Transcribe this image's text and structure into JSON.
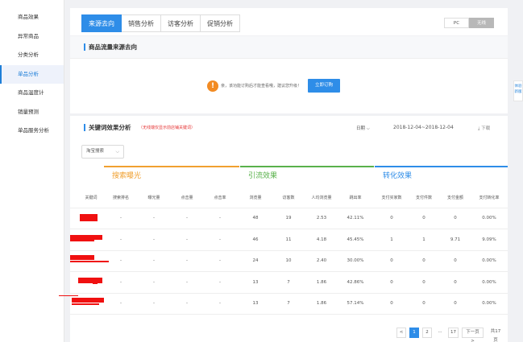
{
  "sidebar": {
    "items": [
      {
        "label": "商品效果"
      },
      {
        "label": "异常商品"
      },
      {
        "label": "分类分析"
      },
      {
        "label": "单品分析"
      },
      {
        "label": "商品温度计"
      },
      {
        "label": "销量预测"
      },
      {
        "label": "单品服务分析"
      }
    ],
    "active_index": 3
  },
  "right_hint": {
    "label": "体验新版"
  },
  "tabs": {
    "items": [
      {
        "label": "来源去向"
      },
      {
        "label": "销售分析"
      },
      {
        "label": "访客分析"
      },
      {
        "label": "促销分析"
      }
    ],
    "active_index": 0
  },
  "device_toggle": {
    "pc": "PC",
    "wireless": "无线",
    "selected": "无线"
  },
  "flow_panel": {
    "title": "商品流量来源去向",
    "notice": "亲，该功能订购后才能查看哦，建议您升级！",
    "upgrade_button": "立即订购"
  },
  "keyword_panel": {
    "title": "关键词效果分析",
    "subtitle": "（无线端仅显示前店铺关键词）",
    "date_label": "日期",
    "date_range": "2018-12-04~2018-12-04",
    "download": "下载",
    "source_select": "淘宝搜索",
    "groups": [
      {
        "label": "搜索曝光",
        "color": "#f0a030"
      },
      {
        "label": "引流效果",
        "color": "#59b14b"
      },
      {
        "label": "转化效果",
        "color": "#2e8de8"
      }
    ],
    "columns": [
      "关键词",
      "搜索排名",
      "曝光量",
      "点击量",
      "点击率",
      "浏览量",
      "访客数",
      "人均浏览量",
      "跳出率",
      "支付买家数",
      "支付件数",
      "支付金额",
      "支付转化率"
    ],
    "rows": [
      {
        "rank": "-",
        "exposure": "-",
        "clicks": "-",
        "ctr": "-",
        "pv": "48",
        "uv": "19",
        "avg_pv": "2.53",
        "bounce": "42.11%",
        "buyers": "0",
        "pieces": "0",
        "amount": "0",
        "conv": "0.00%"
      },
      {
        "rank": "-",
        "exposure": "-",
        "clicks": "-",
        "ctr": "-",
        "pv": "46",
        "uv": "11",
        "avg_pv": "4.18",
        "bounce": "45.45%",
        "buyers": "1",
        "pieces": "1",
        "amount": "9.71",
        "conv": "9.09%"
      },
      {
        "rank": "-",
        "exposure": "-",
        "clicks": "-",
        "ctr": "-",
        "pv": "24",
        "uv": "10",
        "avg_pv": "2.40",
        "bounce": "30.00%",
        "buyers": "0",
        "pieces": "0",
        "amount": "0",
        "conv": "0.00%"
      },
      {
        "rank": "-",
        "exposure": "-",
        "clicks": "-",
        "ctr": "-",
        "pv": "13",
        "uv": "7",
        "avg_pv": "1.86",
        "bounce": "42.86%",
        "buyers": "0",
        "pieces": "0",
        "amount": "0",
        "conv": "0.00%"
      },
      {
        "rank": "-",
        "exposure": "-",
        "clicks": "-",
        "ctr": "-",
        "pv": "13",
        "uv": "7",
        "avg_pv": "1.86",
        "bounce": "57.14%",
        "buyers": "0",
        "pieces": "0",
        "amount": "0",
        "conv": "0.00%"
      }
    ],
    "pagination": {
      "prev": "<",
      "pages": [
        "1",
        "2",
        "...",
        "17"
      ],
      "current": "1",
      "next": "下一页>",
      "total": "共17页"
    }
  }
}
